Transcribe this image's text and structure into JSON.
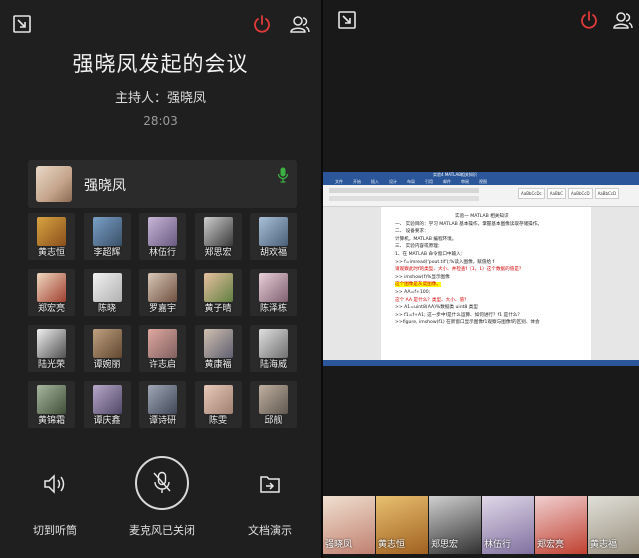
{
  "meeting": {
    "title": "强晓凤发起的会议",
    "host_line": "主持人：强晓凤",
    "timer": "28:03"
  },
  "host_card": {
    "name": "强晓凤"
  },
  "participants": [
    {
      "name": "黄志恒"
    },
    {
      "name": "李超辉"
    },
    {
      "name": "林伍行"
    },
    {
      "name": "郑思宏"
    },
    {
      "name": "胡欢福"
    },
    {
      "name": "郑宏亮"
    },
    {
      "name": "陈晓"
    },
    {
      "name": "罗嘉宇"
    },
    {
      "name": "黄子晴"
    },
    {
      "name": "陈泽栋"
    },
    {
      "name": "陆光荣"
    },
    {
      "name": "谭婉丽"
    },
    {
      "name": "许志启"
    },
    {
      "name": "黄康福"
    },
    {
      "name": "陆海威"
    },
    {
      "name": "黄锦霜"
    },
    {
      "name": "谭庆鑫"
    },
    {
      "name": "谭诗研"
    },
    {
      "name": "陈雯"
    },
    {
      "name": "邱舰"
    }
  ],
  "controls": {
    "speaker_label": "切到听筒",
    "mic_label": "麦克风已关闭",
    "share_label": "文档演示"
  },
  "shared_doc": {
    "window_title": "实验4 MATLAB相关知识",
    "tabs": [
      "文件",
      "开始",
      "插入",
      "设计",
      "布局",
      "引用",
      "邮件",
      "审阅",
      "视图"
    ],
    "styles": [
      "AaBbCcDc",
      "AaBbC",
      "AaBbCcD",
      "AaBbCcD"
    ],
    "lines": [
      {
        "text": "实验一    MATLAB 相关知识",
        "kind": "normal"
      },
      {
        "text": "一、  实验目的：学习 MATLAB 基本操作，掌握基本图像读取存储操作。",
        "kind": "normal"
      },
      {
        "text": "二、  设备要求：",
        "kind": "normal"
      },
      {
        "text": "      计算机，MATLAB 编程环境。",
        "kind": "normal"
      },
      {
        "text": "三、  实验内容或原理：",
        "kind": "normal"
      },
      {
        "text": "1、在 MATLAB 命令窗口中输入：",
        "kind": "normal"
      },
      {
        "text": ">> f=imread('pout.tif');%读入图像，赋值给 f",
        "kind": "normal"
      },
      {
        "text": "请观察此时f的类型、大小、并检查f（1，1）这个数据的值是？",
        "kind": "red"
      },
      {
        "text": ">> imshow(f)%显示图像",
        "kind": "normal"
      },
      {
        "text": "这个图像是灰度图像。",
        "kind": "red-highlight"
      },
      {
        "text": ">> AA=f+100;",
        "kind": "normal"
      },
      {
        "text": "这个 AA 是什么？类型、大小、值？",
        "kind": "red"
      },
      {
        "text": ">> A1=uint8(AA)%数据类 uint8 类型",
        "kind": "normal"
      },
      {
        "text": ">> f1=f+A1;  这一步中f是什么运算、如何进行？f1 是什么？",
        "kind": "mixed"
      },
      {
        "text": "  >>figure, imshow(f1)  在新窗口显示图像f1观察与图像f的区别、体会",
        "kind": "mixed2"
      }
    ]
  },
  "strip": [
    {
      "name": "强晓凤"
    },
    {
      "name": "黄志恒"
    },
    {
      "name": "郑思宏"
    },
    {
      "name": "林伍行"
    },
    {
      "name": "郑宏亮"
    },
    {
      "name": "黄志福"
    }
  ],
  "colors": {
    "power_red": "#e03a3a",
    "mic_green": "#3cb043",
    "word_blue": "#2b579a"
  }
}
